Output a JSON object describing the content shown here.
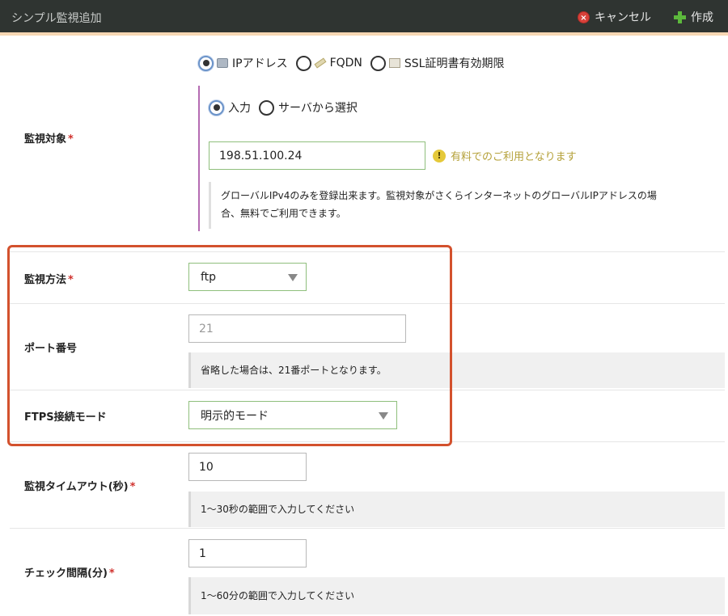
{
  "header": {
    "title": "シンプル監視追加",
    "cancel_label": "キャンセル",
    "create_label": "作成"
  },
  "target": {
    "label": "監視対象",
    "required_mark": "*",
    "types": [
      {
        "label": "IPアドレス",
        "icon": "monitor-icon",
        "selected": true
      },
      {
        "label": "FQDN",
        "icon": "tag-icon",
        "selected": false
      },
      {
        "label": "SSL証明書有効期限",
        "icon": "certificate-icon",
        "selected": false
      }
    ],
    "modes": [
      {
        "label": "入力",
        "selected": true
      },
      {
        "label": "サーバから選択",
        "selected": false
      }
    ],
    "value": "198.51.100.24",
    "warning": "有料でのご利用となります",
    "help_line1": "グローバルIPv4のみを登録出来ます。監視対象がさくらインターネットのグローバルIPアドレスの場",
    "help_line2": "合、無料でご利用できます。"
  },
  "method": {
    "label": "監視方法",
    "required_mark": "*",
    "value": "ftp"
  },
  "port": {
    "label": "ポート番号",
    "placeholder": "21",
    "help": "省略した場合は、21番ポートとなります。"
  },
  "ftps": {
    "label": "FTPS接続モード",
    "value": "明示的モード"
  },
  "timeout": {
    "label": "監視タイムアウト(秒)",
    "required_mark": "*",
    "value": "10",
    "help": "1〜30秒の範囲で入力してください"
  },
  "interval": {
    "label": "チェック間隔(分)",
    "required_mark": "*",
    "value": "1",
    "help": "1〜60分の範囲で入力してください"
  },
  "colors": {
    "header_bg": "#2f3431",
    "highlight_border": "#d3512d",
    "input_border": "#8fbf7c",
    "required": "#d0312d",
    "warning_text": "#b5a13a"
  }
}
